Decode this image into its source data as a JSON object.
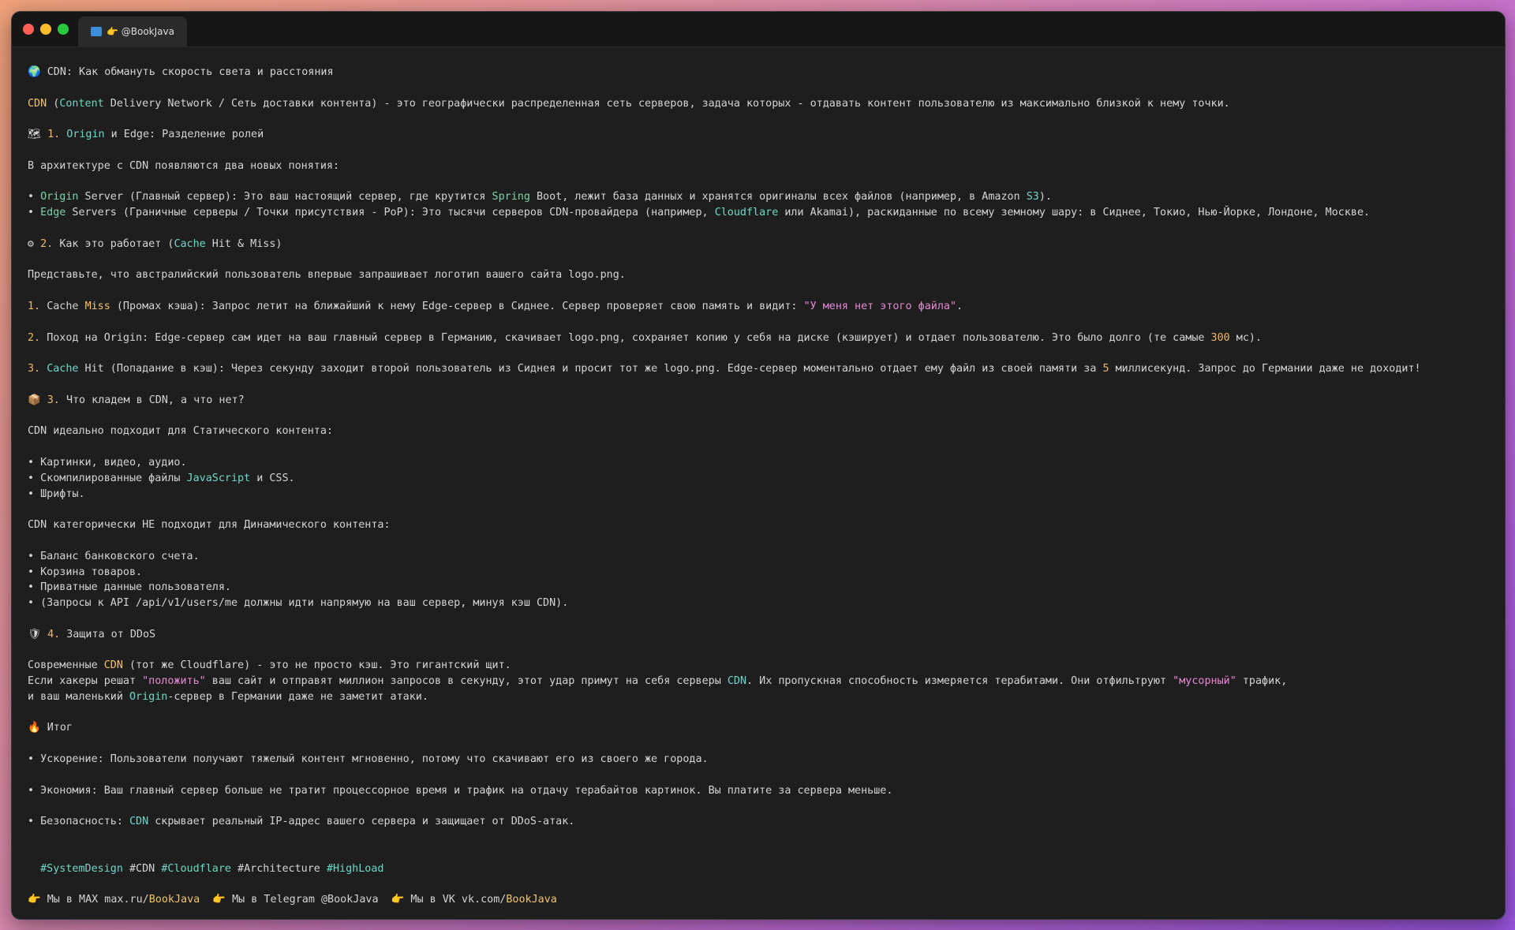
{
  "window": {
    "tab_title": "👉 @BookJava",
    "tab_icon": "terminal-icon"
  },
  "lines": [
    {
      "parts": [
        [
          "🌍 ",
          ""
        ],
        [
          "CDN: Как обмануть скорость света и расстояния",
          ""
        ]
      ]
    },
    {
      "gap": true
    },
    {
      "parts": [
        [
          "CDN",
          "yellow"
        ],
        [
          " (",
          ""
        ],
        [
          "Content",
          "teal"
        ],
        [
          " Delivery Network / Сеть доставки контента) - это географически распределенная сеть серверов, задача которых - отдавать контент пользователю из максимально близкой к нему точки.",
          ""
        ]
      ]
    },
    {
      "gap": true
    },
    {
      "parts": [
        [
          "🗺 ",
          ""
        ],
        [
          "1. ",
          "num"
        ],
        [
          "Origin",
          "teal"
        ],
        [
          " и Edge: Разделение ролей",
          ""
        ]
      ]
    },
    {
      "gap": true
    },
    {
      "parts": [
        [
          "В архитектуре с CDN появляются два новых понятия:",
          ""
        ]
      ]
    },
    {
      "gap": true
    },
    {
      "parts": [
        [
          "• ",
          ""
        ],
        [
          "Origin",
          "green"
        ],
        [
          " Server (Главный сервер): Это ваш настоящий сервер, где крутится ",
          ""
        ],
        [
          "Spring",
          "green"
        ],
        [
          " Boot, лежит база данных и хранятся оригиналы всех файлов (например, в Amazon ",
          ""
        ],
        [
          "S3",
          "teal"
        ],
        [
          ").",
          ""
        ]
      ]
    },
    {
      "parts": [
        [
          "• ",
          ""
        ],
        [
          "Edge",
          "green"
        ],
        [
          " Servers (Граничные серверы / Точки присутствия - PoP): Это тысячи серверов CDN-провайдера (например, ",
          ""
        ],
        [
          "Cloudflare",
          "teal"
        ],
        [
          " или Akamai), раскиданные по всему земному шару: в Сиднее, Токио, Нью-Йорке, Лондоне, Москве.",
          ""
        ]
      ]
    },
    {
      "gap": true
    },
    {
      "parts": [
        [
          "⚙ ",
          ""
        ],
        [
          "2. ",
          "num"
        ],
        [
          "Как это работает (",
          ""
        ],
        [
          "Cache",
          "teal"
        ],
        [
          " Hit & Miss)",
          ""
        ]
      ]
    },
    {
      "gap": true
    },
    {
      "parts": [
        [
          "Представьте, что австралийский пользователь впервые запрашивает логотип вашего сайта logo.png.",
          ""
        ]
      ]
    },
    {
      "gap": true
    },
    {
      "parts": [
        [
          "1. ",
          "num"
        ],
        [
          "Cache ",
          ""
        ],
        [
          "Miss",
          "yellow"
        ],
        [
          " (Промах кэша): Запрос летит на ближайший к нему Edge-сервер в Сиднее. Сервер проверяет свою память и видит: ",
          ""
        ],
        [
          "\"У меня нет этого файла\"",
          "pink"
        ],
        [
          ".",
          ""
        ]
      ]
    },
    {
      "gap": true
    },
    {
      "parts": [
        [
          "2. ",
          "num"
        ],
        [
          "Поход на Origin: Edge-сервер сам идет на ваш главный сервер в Германию, скачивает logo.png, сохраняет копию у себя на диске (кэширует) и отдает пользователю. Это было долго (те самые ",
          ""
        ],
        [
          "300",
          "num"
        ],
        [
          " мс).",
          ""
        ]
      ]
    },
    {
      "gap": true
    },
    {
      "parts": [
        [
          "3. ",
          "num"
        ],
        [
          "Cache",
          "teal"
        ],
        [
          " Hit (Попадание в кэш): Через секунду заходит второй пользователь из Сиднея и просит тот же logo.png. Edge-сервер моментально отдает ему файл из своей памяти за ",
          ""
        ],
        [
          "5",
          "num"
        ],
        [
          " миллисекунд. Запрос до Германии даже не доходит!",
          ""
        ]
      ]
    },
    {
      "gap": true
    },
    {
      "parts": [
        [
          "📦 ",
          ""
        ],
        [
          "3. ",
          "num"
        ],
        [
          "Что кладем в CDN, а что нет?",
          ""
        ]
      ]
    },
    {
      "gap": true
    },
    {
      "parts": [
        [
          "CDN идеально подходит для Статического контента:",
          ""
        ]
      ]
    },
    {
      "gap": true
    },
    {
      "parts": [
        [
          "• Картинки, видео, аудио.",
          ""
        ]
      ]
    },
    {
      "parts": [
        [
          "• Скомпилированные файлы ",
          ""
        ],
        [
          "JavaScript",
          "teal"
        ],
        [
          " и CSS.",
          ""
        ]
      ]
    },
    {
      "parts": [
        [
          "• Шрифты.",
          ""
        ]
      ]
    },
    {
      "gap": true
    },
    {
      "parts": [
        [
          "CDN категорически НЕ подходит для Динамического контента:",
          ""
        ]
      ]
    },
    {
      "gap": true
    },
    {
      "parts": [
        [
          "• Баланс банковского счета.",
          ""
        ]
      ]
    },
    {
      "parts": [
        [
          "• Корзина товаров.",
          ""
        ]
      ]
    },
    {
      "parts": [
        [
          "• Приватные данные пользователя.",
          ""
        ]
      ]
    },
    {
      "parts": [
        [
          "• (Запросы к API /api/v1/users/me должны идти напрямую на ваш сервер, минуя кэш CDN).",
          ""
        ]
      ]
    },
    {
      "gap": true
    },
    {
      "parts": [
        [
          "🛡 ",
          ""
        ],
        [
          "4. ",
          "num"
        ],
        [
          "Защита от DDoS",
          ""
        ]
      ]
    },
    {
      "gap": true
    },
    {
      "parts": [
        [
          "Современные ",
          ""
        ],
        [
          "CDN",
          "yellow"
        ],
        [
          " (тот же Cloudflare) - это не просто кэш. Это гигантский щит.",
          ""
        ]
      ]
    },
    {
      "parts": [
        [
          "Если хакеры решат ",
          ""
        ],
        [
          "\"положить\"",
          "pink"
        ],
        [
          " ваш сайт и отправят миллион запросов в секунду, этот удар примут на себя серверы ",
          ""
        ],
        [
          "CDN",
          "teal"
        ],
        [
          ". Их пропускная способность измеряется терабитами. Они отфильтруют ",
          ""
        ],
        [
          "\"мусорный\"",
          "pink"
        ],
        [
          " трафик,",
          ""
        ]
      ]
    },
    {
      "parts": [
        [
          "и ваш маленький ",
          ""
        ],
        [
          "Origin",
          "teal"
        ],
        [
          "-сервер в Германии даже не заметит атаки.",
          ""
        ]
      ]
    },
    {
      "gap": true
    },
    {
      "parts": [
        [
          "🔥 ",
          ""
        ],
        [
          "Итог",
          ""
        ]
      ]
    },
    {
      "gap": true
    },
    {
      "parts": [
        [
          "• Ускорение: Пользователи получают тяжелый контент мгновенно, потому что скачивают его из своего же города.",
          ""
        ]
      ]
    },
    {
      "gap": true
    },
    {
      "parts": [
        [
          "• Экономия: Ваш главный сервер больше не тратит процессорное время и трафик на отдачу терабайтов картинок. Вы платите за сервера меньше.",
          ""
        ]
      ]
    },
    {
      "gap": true
    },
    {
      "parts": [
        [
          "• Безопасность: ",
          ""
        ],
        [
          "CDN",
          "teal"
        ],
        [
          " скрывает реальный IP-адрес вашего сервера и защищает от DDoS-атак.",
          ""
        ]
      ]
    },
    {
      "gap": true
    },
    {
      "gap": true
    },
    {
      "parts": [
        [
          "  ",
          ""
        ],
        [
          "#SystemDesign",
          "teal"
        ],
        [
          " #CDN ",
          ""
        ],
        [
          "#Cloudflare",
          "teal"
        ],
        [
          " #Architecture ",
          ""
        ],
        [
          "#HighLoad",
          "teal"
        ]
      ]
    },
    {
      "gap": true
    },
    {
      "parts": [
        [
          "👉 ",
          ""
        ],
        [
          "Мы в MAX max.ru/",
          ""
        ],
        [
          "BookJava",
          "yellow"
        ],
        [
          "  👉 ",
          ""
        ],
        [
          "Мы в Telegram @BookJava  ",
          ""
        ],
        [
          "👉 ",
          ""
        ],
        [
          "Мы в VK vk.com/",
          ""
        ],
        [
          "BookJava",
          "yellow"
        ]
      ]
    }
  ]
}
